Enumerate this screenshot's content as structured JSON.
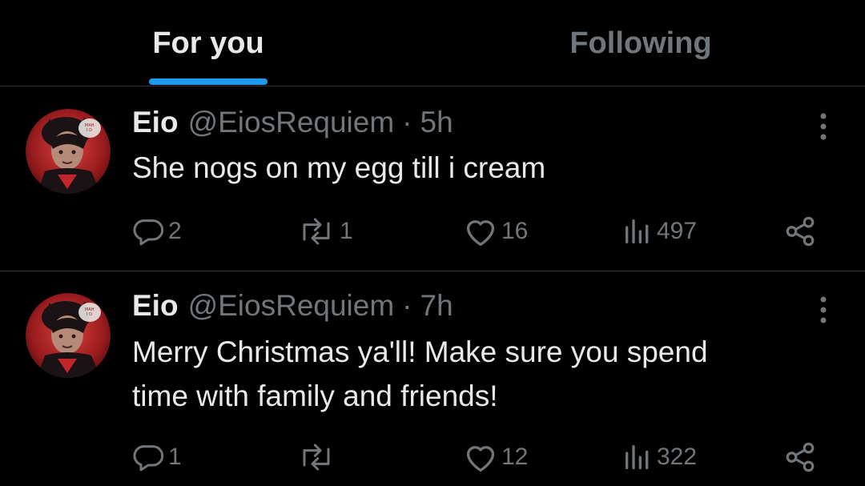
{
  "tabs": {
    "for_you": "For you",
    "following": "Following",
    "active": "for_you",
    "accent_color": "#1d9bf0"
  },
  "posts": [
    {
      "name": "Eio",
      "handle": "@EiosRequiem",
      "separator": "·",
      "time": "5h",
      "text": "She nogs on my egg till i cream",
      "replies": "2",
      "reposts": "1",
      "likes": "16",
      "views": "497"
    },
    {
      "name": "Eio",
      "handle": "@EiosRequiem",
      "separator": "·",
      "time": "7h",
      "text": "Merry Christmas ya'll! Make sure you spend\ntime with family and friends!",
      "replies": "1",
      "reposts": "",
      "likes": "12",
      "views": "322"
    }
  ],
  "icons": {
    "reply": "reply-icon",
    "repost": "repost-icon",
    "like": "heart-icon",
    "views": "views-chart-icon",
    "share": "share-icon",
    "more": "more-dots-icon"
  },
  "colors": {
    "background": "#000000",
    "text_primary": "#e7e9ea",
    "text_secondary": "#71767b",
    "divider": "#2f3336"
  }
}
